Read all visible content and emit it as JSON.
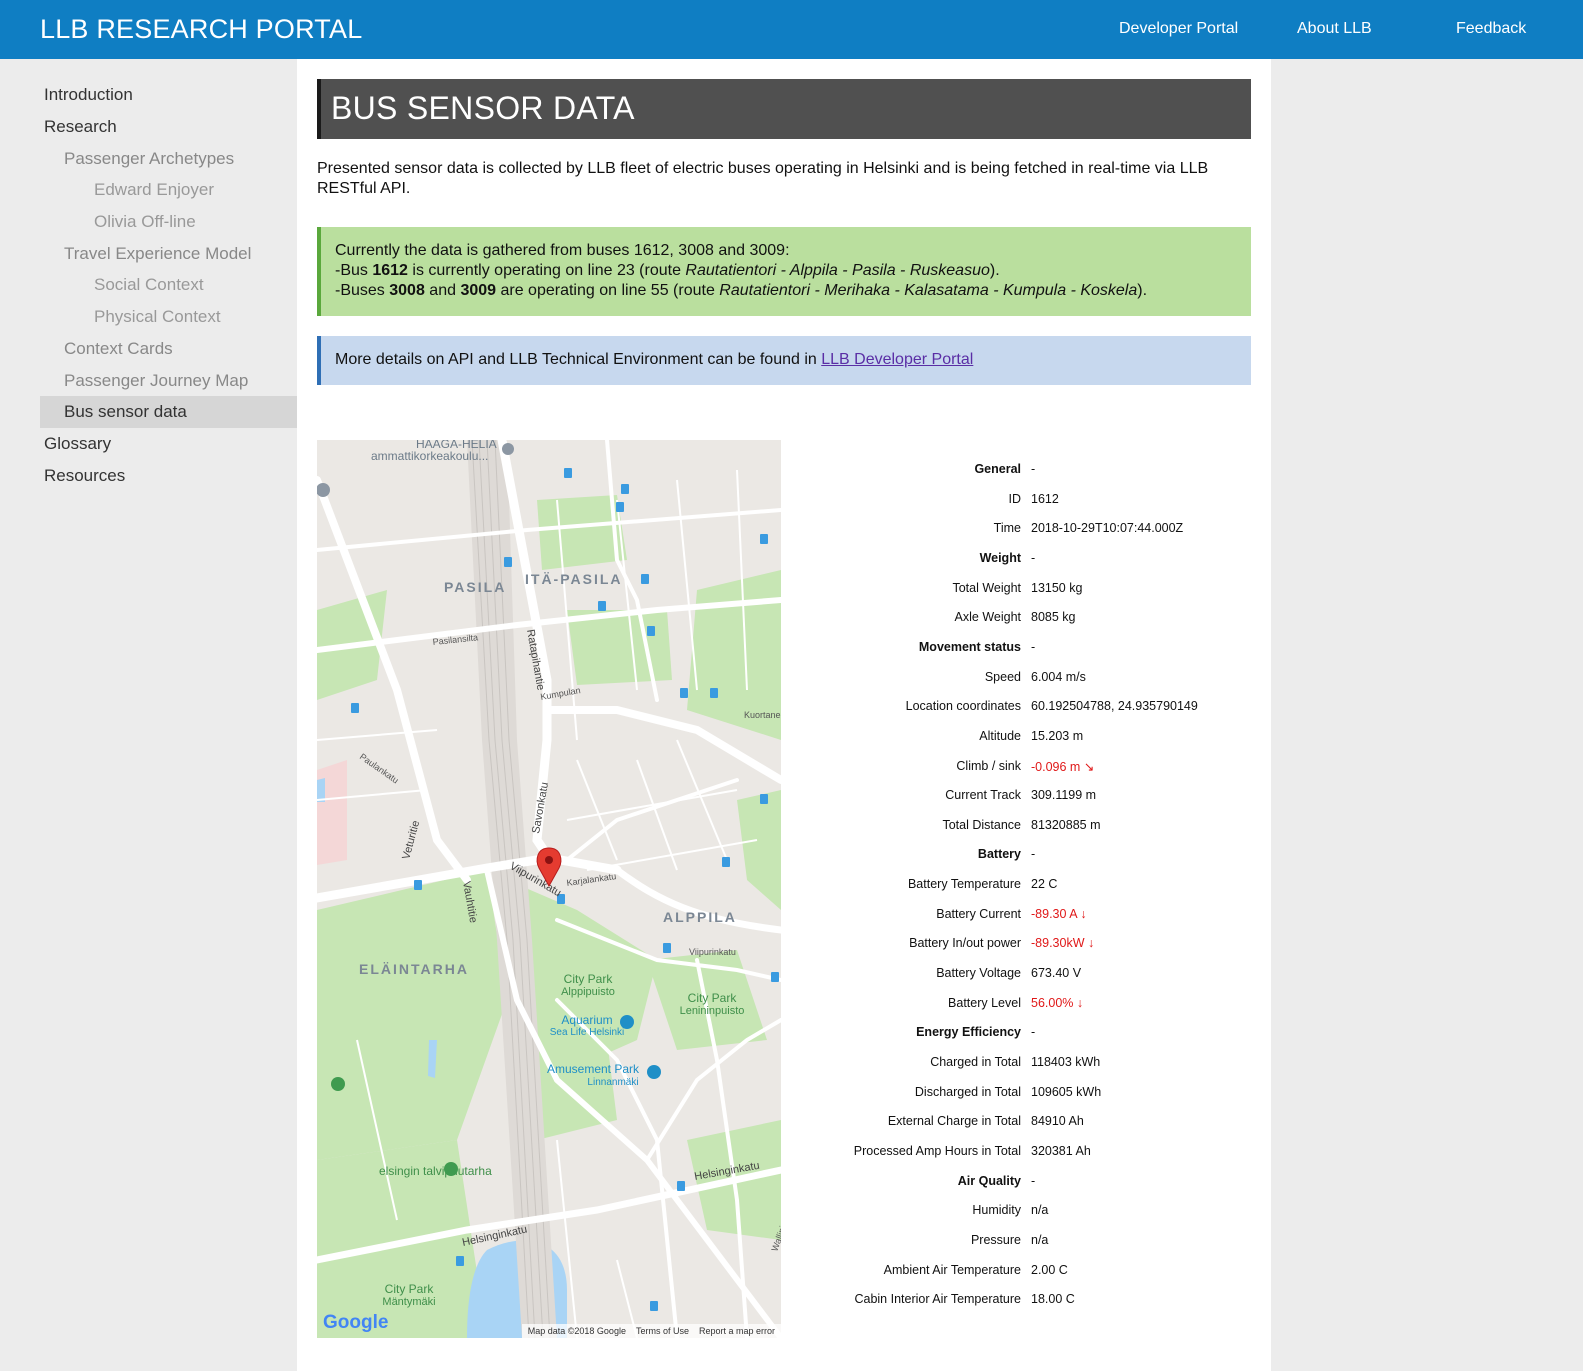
{
  "header": {
    "brand": "LLB RESEARCH PORTAL",
    "nav": [
      "Developer Portal",
      "About LLB",
      "Feedback"
    ]
  },
  "sidebar": {
    "items": [
      {
        "label": "Introduction",
        "level": 1
      },
      {
        "label": "Research",
        "level": 1
      },
      {
        "label": "Passenger Archetypes",
        "level": 2
      },
      {
        "label": "Edward Enjoyer",
        "level": 3
      },
      {
        "label": "Olivia Off-line",
        "level": 3
      },
      {
        "label": "Travel Experience Model",
        "level": 2
      },
      {
        "label": "Social Context",
        "level": 3
      },
      {
        "label": "Physical Context",
        "level": 3
      },
      {
        "label": "Context Cards",
        "level": 2
      },
      {
        "label": "Passenger Journey Map",
        "level": 2
      },
      {
        "label": "Bus sensor data",
        "level": 2,
        "active": true
      },
      {
        "label": "Glossary",
        "level": 1
      },
      {
        "label": "Resources",
        "level": 1
      }
    ]
  },
  "main": {
    "title": "BUS SENSOR DATA",
    "intro": "Presented sensor data is collected by LLB fleet of electric buses operating in Helsinki and is being fetched in real-time via LLB RESTful API.",
    "green": {
      "line1": "Currently the data is gathered from buses 1612, 3008 and 3009:",
      "l2_a": "-Bus ",
      "l2_b": "1612",
      "l2_c": " is currently operating on line 23 (route ",
      "l2_d": "Rautatientori - Alppila - Pasila - Ruskeasuo",
      "l2_e": ").",
      "l3_a": "-Buses ",
      "l3_b": "3008",
      "l3_c": " and ",
      "l3_d": "3009",
      "l3_e": " are operating on line 55 (route ",
      "l3_f": "Rautatientori - Merihaka - Kalasatama - Kumpula - Koskela",
      "l3_g": ")."
    },
    "blue": {
      "text": "More details on API and LLB Technical Environment can be found in ",
      "link": "LLB Developer Portal"
    }
  },
  "map": {
    "labels": {
      "haaga1": "HAAGA-HELIA",
      "haaga2": "ammattikorkeakoulu...",
      "pasila": "PASILA",
      "itapasila": "ITÄ-PASILA",
      "ratapihantie": "Ratapihantie",
      "pasilansilta": "Pasilansilta",
      "savonkatu": "Savonkatu",
      "veturitie": "Veturitie",
      "vauhtitie": "Vauhtitie",
      "viipurinkatu": "Viipurinkatu",
      "karjalankatu": "Karjalankatu",
      "alppila": "ALPPILA",
      "elaintarha": "ELÄINTARHA",
      "cp_alppi1": "City Park",
      "cp_alppi2": "Alppipuisto",
      "cp_lenin1": "City Park",
      "cp_lenin2": "Lenininpuisto",
      "aquarium1": "Aquarium",
      "aquarium2": "Sea Life Helsinki",
      "amuse1": "Amusement Park",
      "amuse2": "Linnanmäki",
      "talvipuutarha": "elsingin talvipuutarha",
      "helsinginkatu1": "Helsinginkatu",
      "helsinginkatu2": "Helsinginkatu",
      "wallininkatu": "Wallininkatu",
      "cp_manty1": "City Park",
      "cp_manty2": "Mäntymäki",
      "kuortane": "Kuortane",
      "kumpula": "Kumpulan",
      "paulankatu": "Paulankatu"
    },
    "logo": "Google",
    "footer": [
      "Map data ©2018 Google",
      "Terms of Use",
      "Report a map error"
    ]
  },
  "sensor": {
    "rows": [
      {
        "k": "General",
        "v": "-",
        "h": true
      },
      {
        "k": "ID",
        "v": "1612"
      },
      {
        "k": "Time",
        "v": "2018-10-29T10:07:44.000Z"
      },
      {
        "k": "Weight",
        "v": "-",
        "h": true
      },
      {
        "k": "Total Weight",
        "v": "13150 kg"
      },
      {
        "k": "Axle Weight",
        "v": "8085 kg"
      },
      {
        "k": "Movement status",
        "v": "-",
        "h": true
      },
      {
        "k": "Speed",
        "v": "6.004 m/s"
      },
      {
        "k": "Location coordinates",
        "v": "60.192504788, 24.935790149"
      },
      {
        "k": "Altitude",
        "v": "15.203 m"
      },
      {
        "k": "Climb / sink",
        "v": "-0.096 m ↘",
        "neg": true
      },
      {
        "k": "Current Track",
        "v": "309.1199 m"
      },
      {
        "k": "Total Distance",
        "v": "81320885 m"
      },
      {
        "k": "Battery",
        "v": "-",
        "h": true
      },
      {
        "k": "Battery Temperature",
        "v": "22 C"
      },
      {
        "k": "Battery Current",
        "v": "-89.30 A ↓",
        "neg": true
      },
      {
        "k": "Battery In/out power",
        "v": "-89.30kW ↓",
        "neg": true
      },
      {
        "k": "Battery Voltage",
        "v": "673.40 V"
      },
      {
        "k": "Battery Level",
        "v": "56.00% ↓",
        "neg": true
      },
      {
        "k": "Energy Efficiency",
        "v": "-",
        "h": true
      },
      {
        "k": "Charged in Total",
        "v": "118403 kWh"
      },
      {
        "k": "Discharged in Total",
        "v": "109605 kWh"
      },
      {
        "k": "External Charge in Total",
        "v": "84910 Ah"
      },
      {
        "k": "Processed Amp Hours in Total",
        "v": "320381 Ah"
      },
      {
        "k": "Air Quality",
        "v": "-",
        "h": true
      },
      {
        "k": "Humidity",
        "v": "n/a"
      },
      {
        "k": "Pressure",
        "v": "n/a"
      },
      {
        "k": "Ambient Air Temperature",
        "v": "2.00 C"
      },
      {
        "k": "Cabin Interior Air Temperature",
        "v": "18.00 C"
      }
    ]
  },
  "colors": {
    "header": "#0f7ec3",
    "green_box": "#badf9e",
    "blue_box": "#c7d8ee",
    "negative": "#e01818"
  }
}
